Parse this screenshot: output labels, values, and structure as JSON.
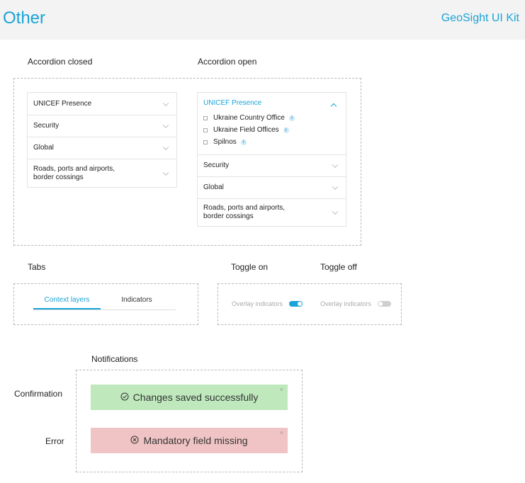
{
  "header": {
    "title": "Other",
    "kit_name": "GeoSight UI Kit"
  },
  "accordion": {
    "closed_label": "Accordion closed",
    "open_label": "Accordion open",
    "items": [
      "UNICEF Presence",
      "Security",
      "Global",
      "Roads, ports and airports, border cossings"
    ],
    "open_item": "UNICEF Presence",
    "open_subitems": [
      "Ukraine Country Office",
      "Ukraine Field Offices",
      "Spilnos"
    ],
    "info_glyph": "i"
  },
  "tabs": {
    "section_label": "Tabs",
    "items": [
      "Context layers",
      "Indicators"
    ],
    "active_index": 0
  },
  "toggles": {
    "on": {
      "title": "Toggle on",
      "label": "Overlay indicators",
      "state": true
    },
    "off": {
      "title": "Toggle off",
      "label": "Overlay indicators",
      "state": false
    }
  },
  "notifications": {
    "section_label": "Notifications",
    "confirmation": {
      "label": "Confirmation",
      "message": "Changes saved successfully",
      "icon": "check-circle-icon",
      "color": "#bfe9bd"
    },
    "error": {
      "label": "Error",
      "message": "Mandatory field missing",
      "icon": "x-circle-icon",
      "color": "#f0c4c4"
    },
    "close_glyph": "×"
  },
  "colors": {
    "accent": "#1aa3d8",
    "topbar": "#f3f3f3"
  }
}
